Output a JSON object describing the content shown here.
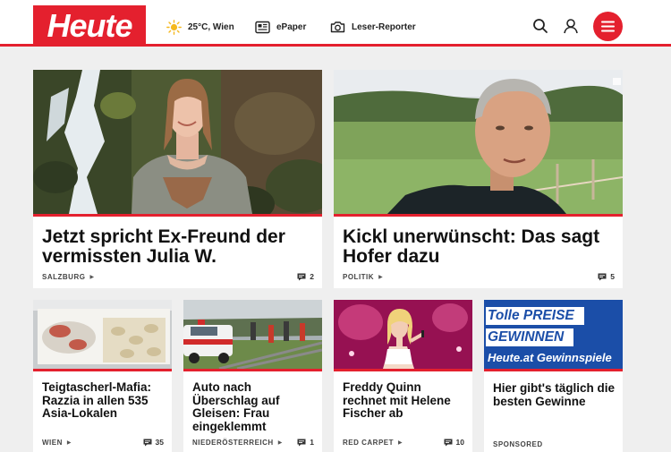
{
  "header": {
    "logo": "Heute",
    "weather": "25°C, Wien",
    "epaper": "ePaper",
    "reporter": "Leser-Reporter"
  },
  "colors": {
    "brand": "#e4202e"
  },
  "articles": [
    {
      "title": "Jetzt spricht Ex-Freund der vermissten Julia W.",
      "category": "SALZBURG",
      "comments": "2"
    },
    {
      "title": "Kickl unerwünscht: Das sagt Hofer dazu",
      "category": "POLITIK",
      "comments": "5"
    },
    {
      "title": "Teigtascherl-Mafia: Razzia in allen 535 Asia-Lokalen",
      "category": "WIEN",
      "comments": "35"
    },
    {
      "title": "Auto nach Überschlag auf Gleisen: Frau eingeklemmt",
      "category": "NIEDERÖSTERREICH",
      "comments": "1"
    },
    {
      "title": "Freddy Quinn rechnet mit Helene Fischer ab",
      "category": "RED CARPET",
      "comments": "10"
    },
    {
      "title": "Hier gibt's täglich die besten Gewinne",
      "category": "SPONSORED"
    }
  ],
  "promo": {
    "line1": "Tolle PREISE",
    "line2": "GEWINNEN",
    "line3": "Heute.at Gewinnspiele"
  }
}
